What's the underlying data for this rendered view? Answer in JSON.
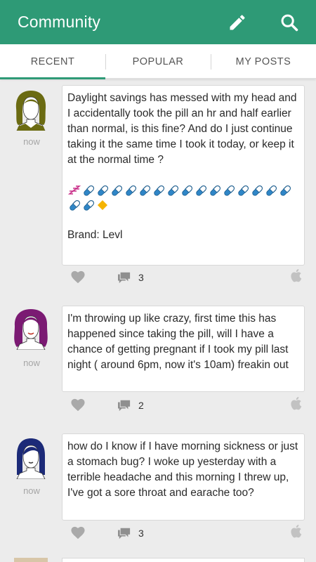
{
  "app": {
    "title": "Community"
  },
  "header": {
    "compose_icon": "pencil-icon",
    "search_icon": "search-icon"
  },
  "tabs": [
    {
      "label": "RECENT",
      "active": true
    },
    {
      "label": "POPULAR",
      "active": false
    },
    {
      "label": "MY POSTS",
      "active": false
    }
  ],
  "posts": [
    {
      "time": "now",
      "avatar": {
        "hair": "#6b6b12"
      },
      "body": "Daylight savings has messed with my head and I accidentally took the pill an hr and half earlier than normal, is this fine? And do I just continue taking it the same time I took it today, or keep it at the normal time ?",
      "emoji_sequence": "zzz + 17 pill emoji + diamond",
      "brand": "Brand: Levl",
      "comment_count": "3"
    },
    {
      "time": "now",
      "avatar": {
        "hair": "#7b1a73"
      },
      "body": "I'm throwing up like crazy, first time this has happened since taking the pill, will I have a chance of getting pregnant if I took my pill last night ( around 6pm, now it's 10am) freakin out",
      "comment_count": "2"
    },
    {
      "time": "now",
      "avatar": {
        "hair": "#1c2a78"
      },
      "body": "how do I know if I have morning sickness or just a stomach bug? I woke up yesterday with a terrible headache and this morning I threw up, I've got a sore throat and earache too?",
      "comment_count": "3"
    }
  ],
  "colors": {
    "accent": "#2e9a76",
    "pill_blue": "#2f86c7",
    "pill_dark": "#1f5f8f",
    "diamond": "#f5b400",
    "zzz": "#c9308a"
  }
}
